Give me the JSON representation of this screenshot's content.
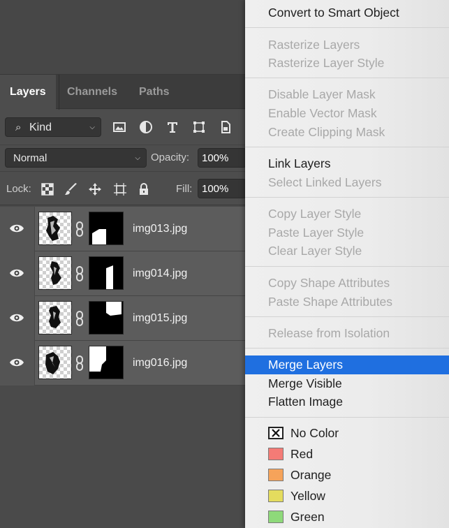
{
  "layers_panel": {
    "tabs": [
      "Layers",
      "Channels",
      "Paths"
    ],
    "filter_kind": "Kind",
    "blend_mode": "Normal",
    "opacity_label": "Opacity:",
    "opacity_value": "100%",
    "lock_label": "Lock:",
    "fill_label": "Fill:",
    "fill_value": "100%",
    "layers": [
      {
        "name": "img013.jpg"
      },
      {
        "name": "img014.jpg"
      },
      {
        "name": "img015.jpg"
      },
      {
        "name": "img016.jpg"
      }
    ]
  },
  "context_menu": {
    "items": [
      {
        "label": "Convert to Smart Object",
        "enabled": true
      },
      {
        "label": "Rasterize Layers",
        "enabled": false
      },
      {
        "label": "Rasterize Layer Style",
        "enabled": false
      },
      {
        "label": "Disable Layer Mask",
        "enabled": false
      },
      {
        "label": "Enable Vector Mask",
        "enabled": false
      },
      {
        "label": "Create Clipping Mask",
        "enabled": false
      },
      {
        "label": "Link Layers",
        "enabled": true
      },
      {
        "label": "Select Linked Layers",
        "enabled": false
      },
      {
        "label": "Copy Layer Style",
        "enabled": false
      },
      {
        "label": "Paste Layer Style",
        "enabled": false
      },
      {
        "label": "Clear Layer Style",
        "enabled": false
      },
      {
        "label": "Copy Shape Attributes",
        "enabled": false
      },
      {
        "label": "Paste Shape Attributes",
        "enabled": false
      },
      {
        "label": "Release from Isolation",
        "enabled": false
      },
      {
        "label": "Merge Layers",
        "enabled": true,
        "highlighted": true
      },
      {
        "label": "Merge Visible",
        "enabled": true
      },
      {
        "label": "Flatten Image",
        "enabled": true
      }
    ],
    "colors": [
      {
        "label": "No Color",
        "swatch": "none"
      },
      {
        "label": "Red",
        "swatch": "#f47b76"
      },
      {
        "label": "Orange",
        "swatch": "#f6a35a"
      },
      {
        "label": "Yellow",
        "swatch": "#e4dc5e"
      },
      {
        "label": "Green",
        "swatch": "#8ed97a"
      }
    ]
  }
}
